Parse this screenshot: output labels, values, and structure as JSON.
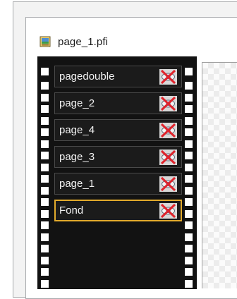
{
  "document": {
    "file_name": "page_1.pfi",
    "file_icon": "image-file-icon"
  },
  "layers": [
    {
      "name": "pagedouble",
      "visibility_icon": "hidden-eye-icon",
      "selected": false
    },
    {
      "name": "page_2",
      "visibility_icon": "hidden-eye-icon",
      "selected": false
    },
    {
      "name": "page_4",
      "visibility_icon": "hidden-eye-icon",
      "selected": false
    },
    {
      "name": "page_3",
      "visibility_icon": "hidden-eye-icon",
      "selected": false
    },
    {
      "name": "page_1",
      "visibility_icon": "hidden-eye-icon",
      "selected": false
    },
    {
      "name": "Fond",
      "visibility_icon": "hidden-eye-icon",
      "selected": true
    }
  ],
  "colors": {
    "filmstrip": "#121212",
    "selection_border": "#e2aa2c",
    "hidden_cross": "#e0242c",
    "eye_blue": "#3f86c4"
  }
}
